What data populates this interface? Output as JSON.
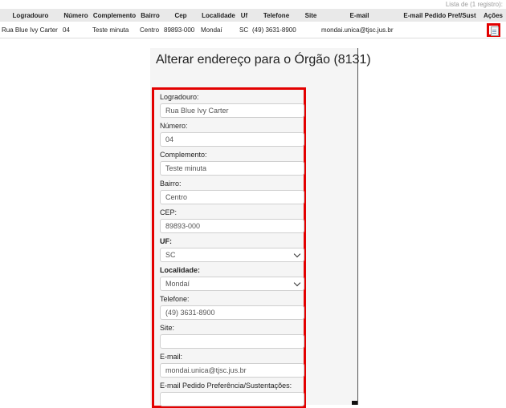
{
  "list_caption": "Lista de (1 registro):",
  "table": {
    "headers": [
      "Logradouro",
      "Número",
      "Complemento",
      "Bairro",
      "Cep",
      "Localidade",
      "Uf",
      "Telefone",
      "Site",
      "E-mail",
      "E-mail Pedido Pref/Sust",
      "Ações"
    ],
    "row": {
      "logradouro": "Rua Blue Ivy Carter",
      "numero": "04",
      "complemento": "Teste minuta",
      "bairro": "Centro",
      "cep": "89893-000",
      "localidade": "Mondaí",
      "uf": "SC",
      "telefone": "(49) 3631-8900",
      "site": "",
      "email": "mondai.unica@tjsc.jus.br",
      "email_pref": "",
      "action_icon": "edit-document-icon"
    }
  },
  "form": {
    "title": "Alterar endereço para o Órgão (8131)",
    "fields": [
      {
        "label": "Logradouro:",
        "value": "Rua Blue Ivy Carter"
      },
      {
        "label": "Número:",
        "value": "04"
      },
      {
        "label": "Complemento:",
        "value": "Teste minuta"
      },
      {
        "label": "Bairro:",
        "value": "Centro"
      },
      {
        "label": "CEP:",
        "value": "89893-000"
      },
      {
        "label": "UF:",
        "value": "SC"
      },
      {
        "label": "Localidade:",
        "value": "Mondaí"
      },
      {
        "label": "Telefone:",
        "value": "(49) 3631-8900"
      },
      {
        "label": "Site:",
        "value": ""
      },
      {
        "label": "E-mail:",
        "value": "mondai.unica@tjsc.jus.br"
      },
      {
        "label": "E-mail Pedido Preferência/Sustentações:",
        "value": ""
      }
    ]
  },
  "colors": {
    "highlight": "#e30000",
    "header_bg": "#e9e9e9"
  }
}
